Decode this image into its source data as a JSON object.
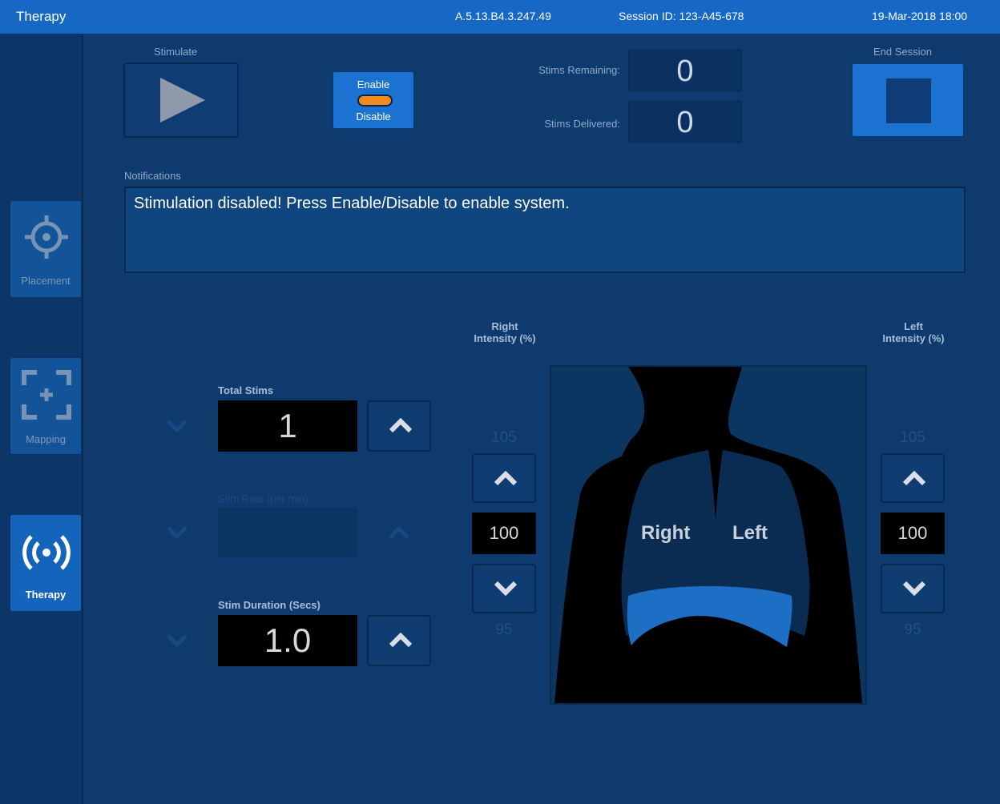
{
  "topbar": {
    "title": "Therapy",
    "version": "A.5.13.B4.3.247.49",
    "session": "Session ID: 123-A45-678",
    "datetime": "19-Mar-2018  18:00"
  },
  "sidebar": {
    "items": [
      {
        "label": "Placement",
        "icon": "crosshair-icon",
        "active": false
      },
      {
        "label": "Mapping",
        "icon": "mapping-icon",
        "active": false
      },
      {
        "label": "Therapy",
        "icon": "broadcast-icon",
        "active": true
      }
    ]
  },
  "controls": {
    "stimulate_label": "Stimulate",
    "enable_label": "Enable",
    "disable_label": "Disable",
    "stims_remaining_label": "Stims Remaining:",
    "stims_remaining_value": "0",
    "stims_delivered_label": "Stims Delivered:",
    "stims_delivered_value": "0",
    "end_session_label": "End Session"
  },
  "notifications": {
    "label": "Notifications",
    "message": "Stimulation disabled! Press Enable/Disable to enable system."
  },
  "settings": {
    "total_stims_label": "Total Stims",
    "total_stims_value": "1",
    "stim_rate_label": "Stim Rate (per min)",
    "stim_rate_value": "",
    "stim_duration_label": "Stim Duration (Secs)",
    "stim_duration_value": "1.0"
  },
  "intensity": {
    "right_label_1": "Right",
    "right_label_2": "Intensity (%)",
    "right_max": "105",
    "right_value": "100",
    "right_min": "95",
    "left_label_1": "Left",
    "left_label_2": "Intensity (%)",
    "left_max": "105",
    "left_value": "100",
    "left_min": "95"
  },
  "diagram": {
    "right_lung_label": "Right",
    "left_lung_label": "Left"
  },
  "colors": {
    "background": "#0e3a6e",
    "topbar": "#1668c4",
    "accent_blue": "#1c72d0",
    "enable_toggle": "#f08a1c",
    "diaphragm": "#1c6fc4"
  }
}
